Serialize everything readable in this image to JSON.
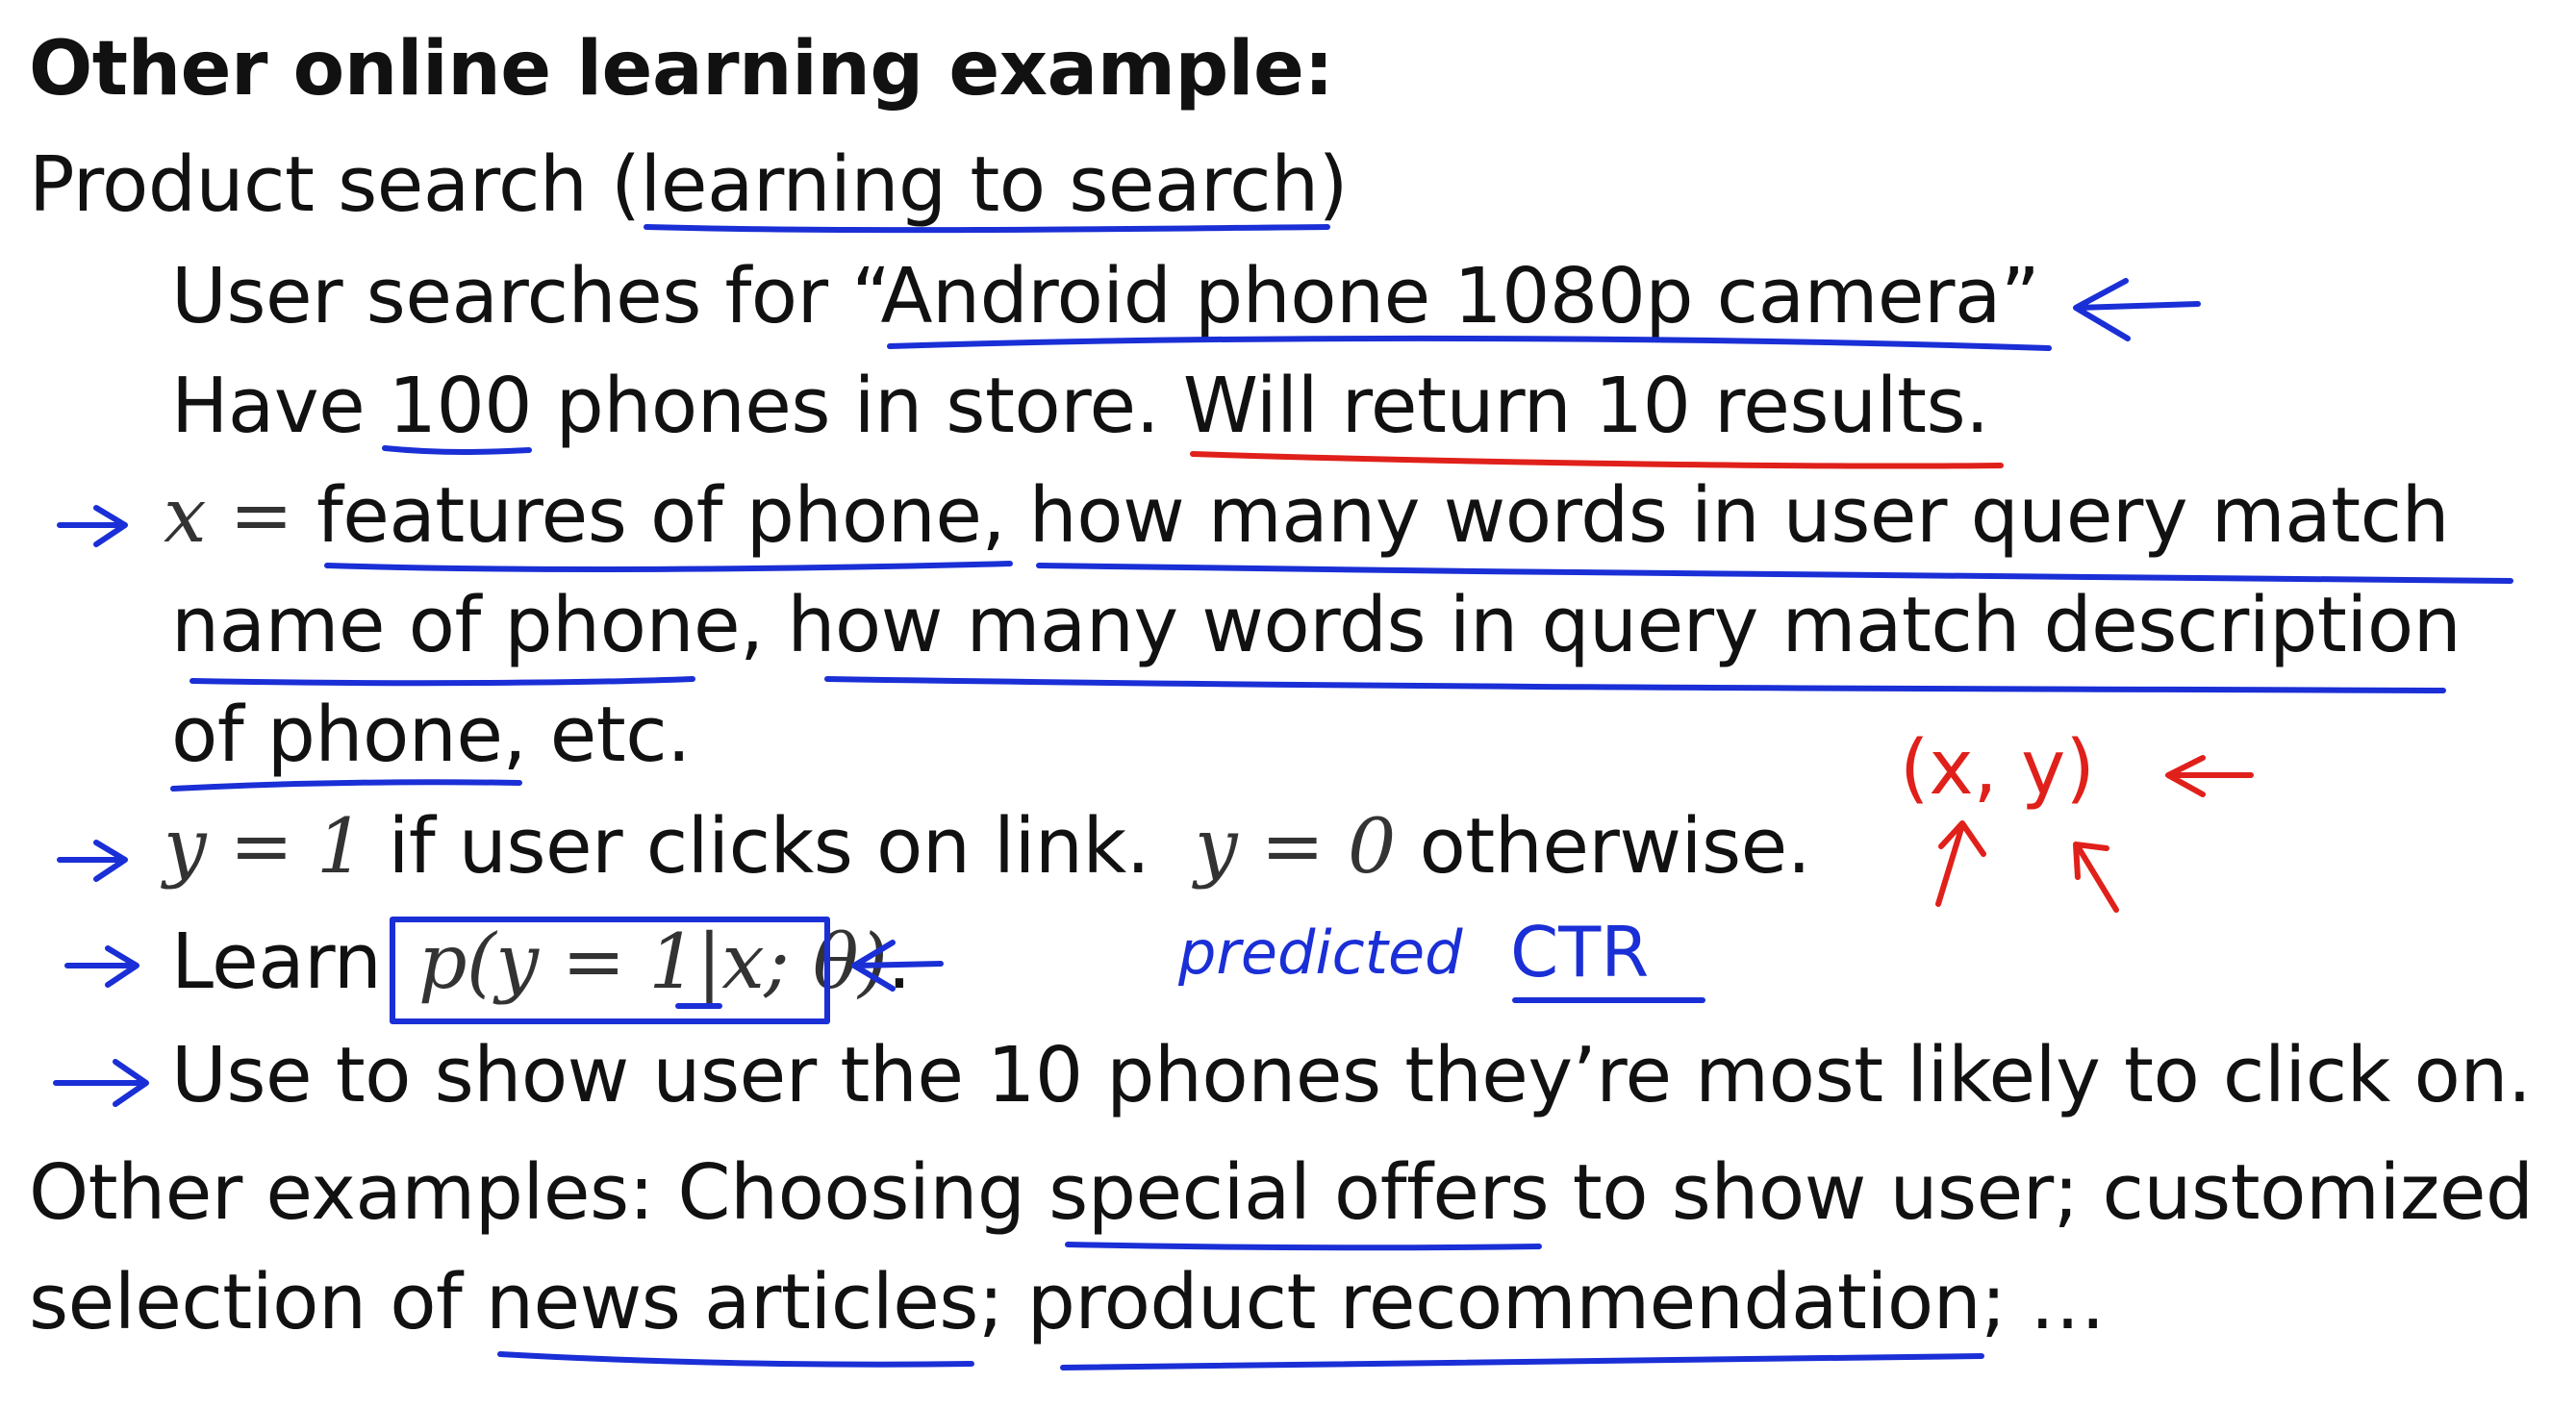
{
  "slide": {
    "title": "Other online learning example:",
    "line1": "Product search (learning to search)",
    "line2": "User searches for “Android phone 1080p camera”",
    "line3": "Have 100 phones in store. Will return 10 results.",
    "line4_math": "x =",
    "line4_text": "features of phone, how many words in user query match",
    "line5": "name of phone, how many words in query match description",
    "line6": "of phone, etc.",
    "line7_math1": "y = 1",
    "line7_text1": "if user clicks on link.",
    "line7_math2": "y = 0",
    "line7_text2": "otherwise.",
    "line8_text": "Learn",
    "line8_math": "p(y = 1|x; θ)",
    "line8_end": ".",
    "line9": "Use to show user the 10 phones they’re most likely to click on.",
    "line10": "Other examples: Choosing special offers to show user; customized",
    "line11": "selection of news articles; product recommendation; …"
  },
  "annotations": {
    "xy_note": "(x, y)",
    "predicted_note": "predicted",
    "ctr_note": "CTR"
  },
  "colors": {
    "text": "#111111",
    "blue_ink": "#1a2fd6",
    "red_ink": "#e0201a"
  }
}
